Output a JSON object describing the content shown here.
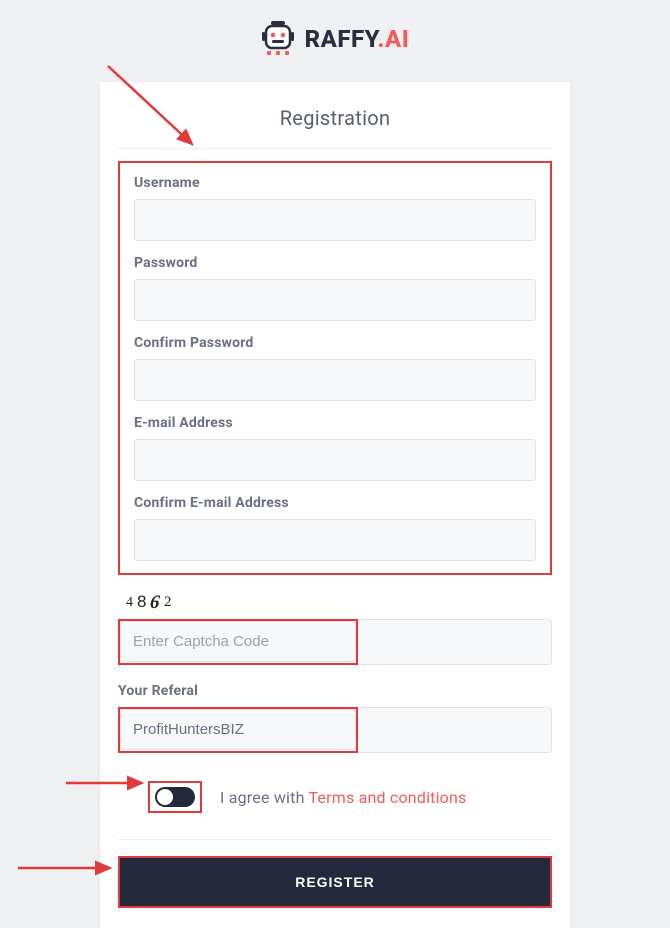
{
  "logo": {
    "text_main": "RAFFY",
    "text_accent": ".AI"
  },
  "card": {
    "title": "Registration"
  },
  "fields": {
    "username": {
      "label": "Username",
      "value": ""
    },
    "password": {
      "label": "Password",
      "value": ""
    },
    "confirm_password": {
      "label": "Confirm Password",
      "value": ""
    },
    "email": {
      "label": "E-mail Address",
      "value": ""
    },
    "confirm_email": {
      "label": "Confirm E-mail Address",
      "value": ""
    }
  },
  "captcha": {
    "digits": [
      "4",
      "8",
      "6",
      "2"
    ],
    "placeholder": "Enter Captcha Code",
    "value": ""
  },
  "referal": {
    "label": "Your Referal",
    "value": "ProfitHuntersBIZ"
  },
  "agree": {
    "prefix": "I agree with ",
    "link": "Terms and conditions"
  },
  "actions": {
    "register": "REGISTER"
  },
  "colors": {
    "accent": "#f15b5b",
    "highlight": "#e03a3a",
    "dark": "#23283a"
  }
}
